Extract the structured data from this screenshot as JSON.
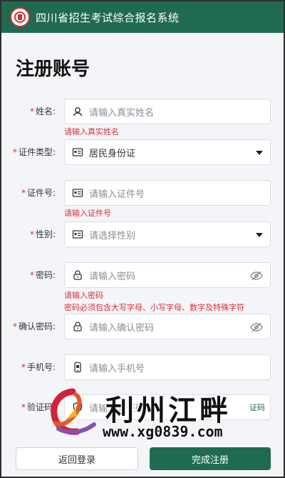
{
  "header": {
    "title": "四川省招生考试综合报名系统"
  },
  "page_title": "注册账号",
  "form": {
    "name": {
      "label": "姓名:",
      "placeholder": "请输入真实姓名",
      "error": "请输入真实姓名"
    },
    "id_type": {
      "label": "证件类型:",
      "value": "居民身份证"
    },
    "id_number": {
      "label": "证件号:",
      "placeholder": "请输入证件号",
      "error": "请输入证件号"
    },
    "gender": {
      "label": "性别:",
      "placeholder": "请选择性别"
    },
    "password": {
      "label": "密码:",
      "placeholder": "请输入密码",
      "error": "请输入密码",
      "hint": "密码必须包含大写字母、小写字母、数字及特殊字符"
    },
    "confirm_password": {
      "label": "确认密码:",
      "placeholder": "请输入确认密码"
    },
    "phone": {
      "label": "手机号:",
      "placeholder": "请输入手机号"
    },
    "captcha": {
      "label": "验证码:",
      "placeholder": "请输入验证码",
      "button": "证码"
    }
  },
  "buttons": {
    "back": "返回登录",
    "submit": "完成注册"
  },
  "watermark": {
    "title": "利州江畔",
    "url": "www.xg0839.com"
  },
  "colors": {
    "primary": "#1f6b52",
    "error": "#d9303a",
    "background": "#f3f5f8"
  },
  "icons": {
    "name": "user-icon",
    "id_type": "id-card-icon",
    "id_number": "id-card-icon",
    "gender": "id-card-icon",
    "password": "lock-icon",
    "confirm_password": "lock-icon",
    "phone": "phone-icon",
    "eye": "eye-off-icon"
  }
}
